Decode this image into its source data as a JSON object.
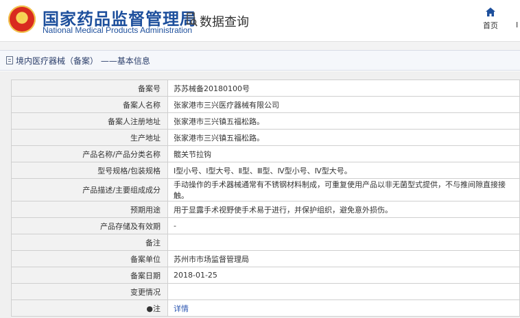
{
  "header": {
    "org_name_cn": "国家药品监督管理局",
    "org_name_en": "National Medical Products Administration",
    "section_title": "数据查询",
    "nav": {
      "home_label": "首页",
      "next_cut": "I"
    }
  },
  "breadcrumb": {
    "text": "境内医疗器械（备案） ——基本信息"
  },
  "record": {
    "rows": [
      {
        "label": "备案号",
        "value": "苏苏械备20180100号"
      },
      {
        "label": "备案人名称",
        "value": "张家港市三兴医疗器械有限公司"
      },
      {
        "label": "备案人注册地址",
        "value": "张家港市三兴镇五福松路。"
      },
      {
        "label": "生产地址",
        "value": "张家港市三兴镇五福松路。"
      },
      {
        "label": "产品名称/产品分类名称",
        "value": "髋关节拉钩"
      },
      {
        "label": "型号规格/包装规格",
        "value": "Ⅰ型小号、Ⅰ型大号、Ⅱ型、Ⅲ型、Ⅳ型小号、Ⅳ型大号。"
      },
      {
        "label": "产品描述/主要组成成分",
        "value": "手动操作的手术器械通常有不锈钢材料制成，可重复使用产品以非无菌型式提供，不与推间隙直接接触。"
      },
      {
        "label": "预期用途",
        "value": "用于显露手术视野使手术易于进行，并保护组织，避免意外损伤。"
      },
      {
        "label": "产品存储及有效期",
        "value": "-"
      },
      {
        "label": "备注",
        "value": ""
      },
      {
        "label": "备案单位",
        "value": "苏州市市场监督管理局"
      },
      {
        "label": "备案日期",
        "value": "2018-01-25"
      },
      {
        "label": "变更情况",
        "value": ""
      },
      {
        "label": "●注",
        "value": "详情"
      }
    ]
  },
  "colors": {
    "brand_blue": "#1d4f9c",
    "link_blue": "#2c56b1",
    "label_bg": "#f2f2f2",
    "border": "#cfcfcf"
  }
}
